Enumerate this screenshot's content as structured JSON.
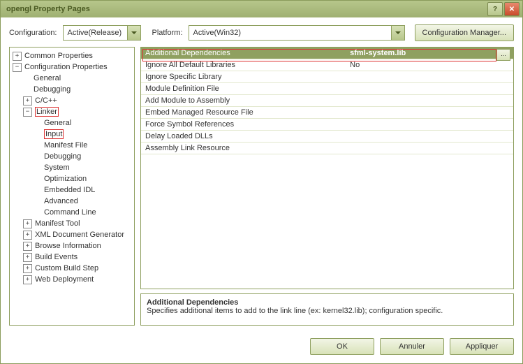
{
  "window": {
    "title": "opengl Property Pages"
  },
  "cfgbar": {
    "configuration_label": "Configuration:",
    "configuration_value": "Active(Release)",
    "platform_label": "Platform:",
    "platform_value": "Active(Win32)",
    "manager_button": "Configuration Manager..."
  },
  "tree": {
    "common": "Common Properties",
    "config": "Configuration Properties",
    "general": "General",
    "debugging": "Debugging",
    "cpp": "C/C++",
    "linker": "Linker",
    "linker_general": "General",
    "linker_input": "Input",
    "linker_manifest": "Manifest File",
    "linker_debugging": "Debugging",
    "linker_system": "System",
    "linker_optimization": "Optimization",
    "linker_embeddedidl": "Embedded IDL",
    "linker_advanced": "Advanced",
    "linker_cmdline": "Command Line",
    "manifest_tool": "Manifest Tool",
    "xml_gen": "XML Document Generator",
    "browse": "Browse Information",
    "build_events": "Build Events",
    "custom_step": "Custom Build Step",
    "web_deploy": "Web Deployment"
  },
  "grid": [
    {
      "key": "Additional Dependencies",
      "val": "sfml-system.lib",
      "selected": true
    },
    {
      "key": "Ignore All Default Libraries",
      "val": "No"
    },
    {
      "key": "Ignore Specific Library",
      "val": ""
    },
    {
      "key": "Module Definition File",
      "val": ""
    },
    {
      "key": "Add Module to Assembly",
      "val": ""
    },
    {
      "key": "Embed Managed Resource File",
      "val": ""
    },
    {
      "key": "Force Symbol References",
      "val": ""
    },
    {
      "key": "Delay Loaded DLLs",
      "val": ""
    },
    {
      "key": "Assembly Link Resource",
      "val": ""
    }
  ],
  "ellipsis": "...",
  "desc": {
    "title": "Additional Dependencies",
    "text": "Specifies additional items to add to the link line (ex: kernel32.lib); configuration specific."
  },
  "footer": {
    "ok": "OK",
    "cancel": "Annuler",
    "apply": "Appliquer"
  }
}
